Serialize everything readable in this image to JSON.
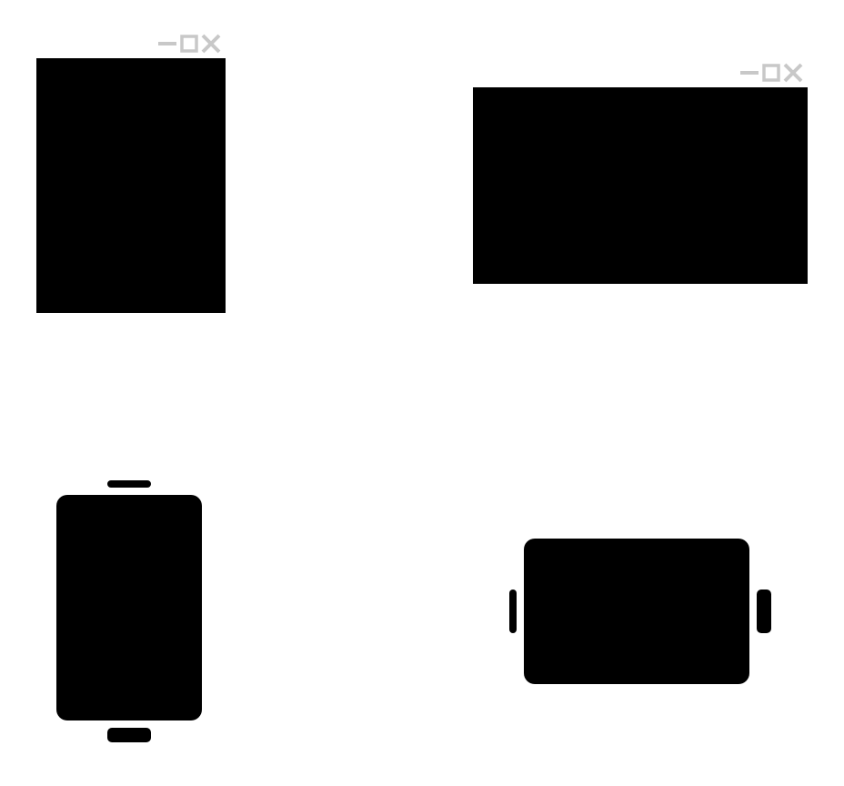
{
  "colors": {
    "background": "#ffffff",
    "screen_fill": "#000000",
    "window_control_color": "#c8c8c8"
  },
  "panels": {
    "desktop_portrait": {
      "kind": "desktop-window",
      "orientation": "portrait",
      "controls": [
        "minimize-icon",
        "maximize-icon",
        "close-icon"
      ]
    },
    "desktop_landscape": {
      "kind": "desktop-window",
      "orientation": "landscape",
      "controls": [
        "minimize-icon",
        "maximize-icon",
        "close-icon"
      ]
    },
    "mobile_portrait": {
      "kind": "mobile-device",
      "orientation": "portrait"
    },
    "mobile_landscape": {
      "kind": "mobile-device",
      "orientation": "landscape"
    }
  }
}
